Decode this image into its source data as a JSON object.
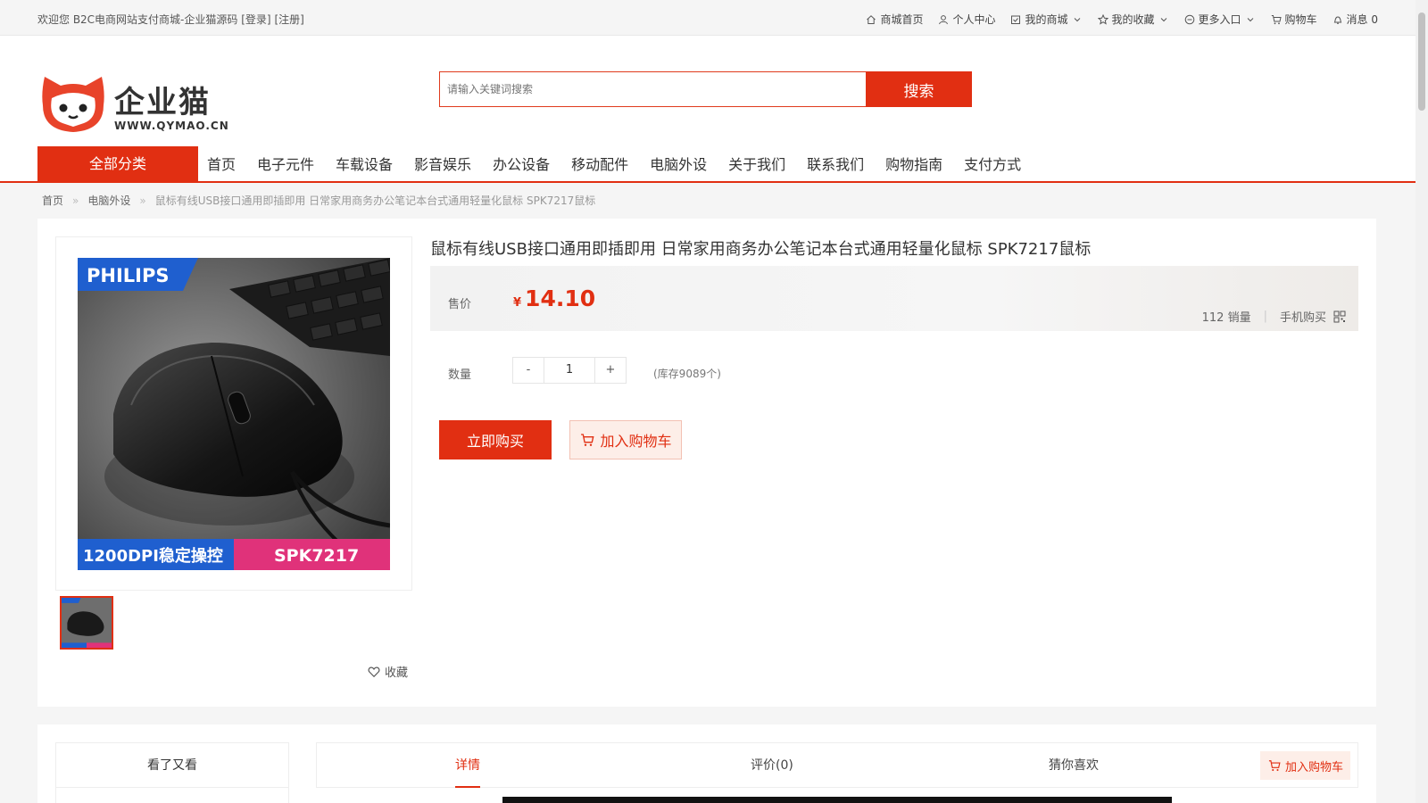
{
  "topbar": {
    "welcome": "欢迎您 B2C电商网站支付商城-企业猫源码",
    "login": "[登录]",
    "register": "[注册]",
    "links": [
      {
        "label": "商城首页",
        "icon": "home-icon"
      },
      {
        "label": "个人中心",
        "icon": "user-icon"
      },
      {
        "label": "我的商城",
        "icon": "calendar-icon",
        "dropdown": true
      },
      {
        "label": "我的收藏",
        "icon": "star-icon",
        "dropdown": true
      },
      {
        "label": "更多入口",
        "icon": "more-circle-icon",
        "dropdown": true
      },
      {
        "label": "购物车",
        "icon": "cart-icon"
      },
      {
        "label": "消息 0",
        "icon": "bell-icon"
      }
    ]
  },
  "logo": {
    "brand": "企业猫",
    "url": "WWW.QYMAO.CN"
  },
  "search": {
    "placeholder": "请输入关键词搜索",
    "button": "搜索"
  },
  "nav": {
    "all_categories": "全部分类",
    "items": [
      "首页",
      "电子元件",
      "车载设备",
      "影音娱乐",
      "办公设备",
      "移动配件",
      "电脑外设",
      "关于我们",
      "联系我们",
      "购物指南",
      "支付方式"
    ]
  },
  "breadcrumb": {
    "home": "首页",
    "category": "电脑外设",
    "current": "鼠标有线USB接口通用即插即用 日常家用商务办公笔记本台式通用轻量化鼠标 SPK7217鼠标",
    "separator": "»"
  },
  "product": {
    "title": "鼠标有线USB接口通用即插即用 日常家用商务办公笔记本台式通用轻量化鼠标 SPK7217鼠标",
    "price_label": "售价",
    "currency": "¥",
    "price": "14.10",
    "sales": "112 销量",
    "mobile_buy": "手机购买",
    "qty_label": "数量",
    "qty_minus": "-",
    "qty_value": "1",
    "qty_plus": "+",
    "stock": "(库存9089个)",
    "buy_now": "立即购买",
    "add_to_cart": "加入购物车",
    "favorite": "收藏",
    "image": {
      "brand": "PHILIPS",
      "caption_left": "1200DPI稳定操控",
      "caption_right": "SPK7217"
    }
  },
  "lower": {
    "seen_title": "看了又看",
    "tabs": [
      "详情",
      "评价(0)",
      "猜你喜欢"
    ],
    "add_to_cart": "加入购物车"
  },
  "colors": {
    "accent": "#e12f12",
    "philips_blue": "#1f5fcf",
    "caption_pink": "#e0327a"
  }
}
